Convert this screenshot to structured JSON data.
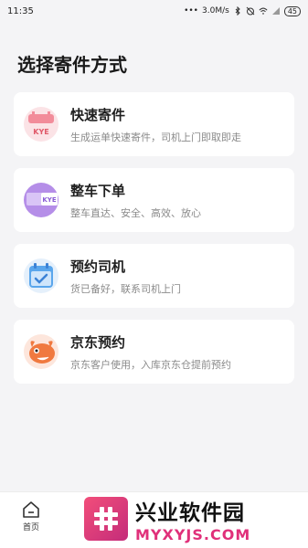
{
  "status_bar": {
    "time": "11:35",
    "network_speed": "3.0M/s",
    "battery": "45"
  },
  "page": {
    "title": "选择寄件方式"
  },
  "options": [
    {
      "title": "快速寄件",
      "desc": "生成运单快速寄件，司机上门即取即走",
      "icon": "kye-express-icon",
      "icon_label": "KYE"
    },
    {
      "title": "整车下单",
      "desc": "整车直达、安全、高效、放心",
      "icon": "kye-truck-icon",
      "icon_label": "KYE"
    },
    {
      "title": "预约司机",
      "desc": "货已备好，联系司机上门",
      "icon": "calendar-check-icon"
    },
    {
      "title": "京东预约",
      "desc": "京东客户使用，入库京东仓提前预约",
      "icon": "jd-dog-icon"
    }
  ],
  "bottom_nav": {
    "home_label": "首页"
  },
  "watermark": {
    "main": "兴业软件园",
    "sub": "MYXYJS.COM"
  },
  "colors": {
    "background": "#f4f4f6",
    "card": "#ffffff",
    "accent_pink": "#e0307a"
  }
}
